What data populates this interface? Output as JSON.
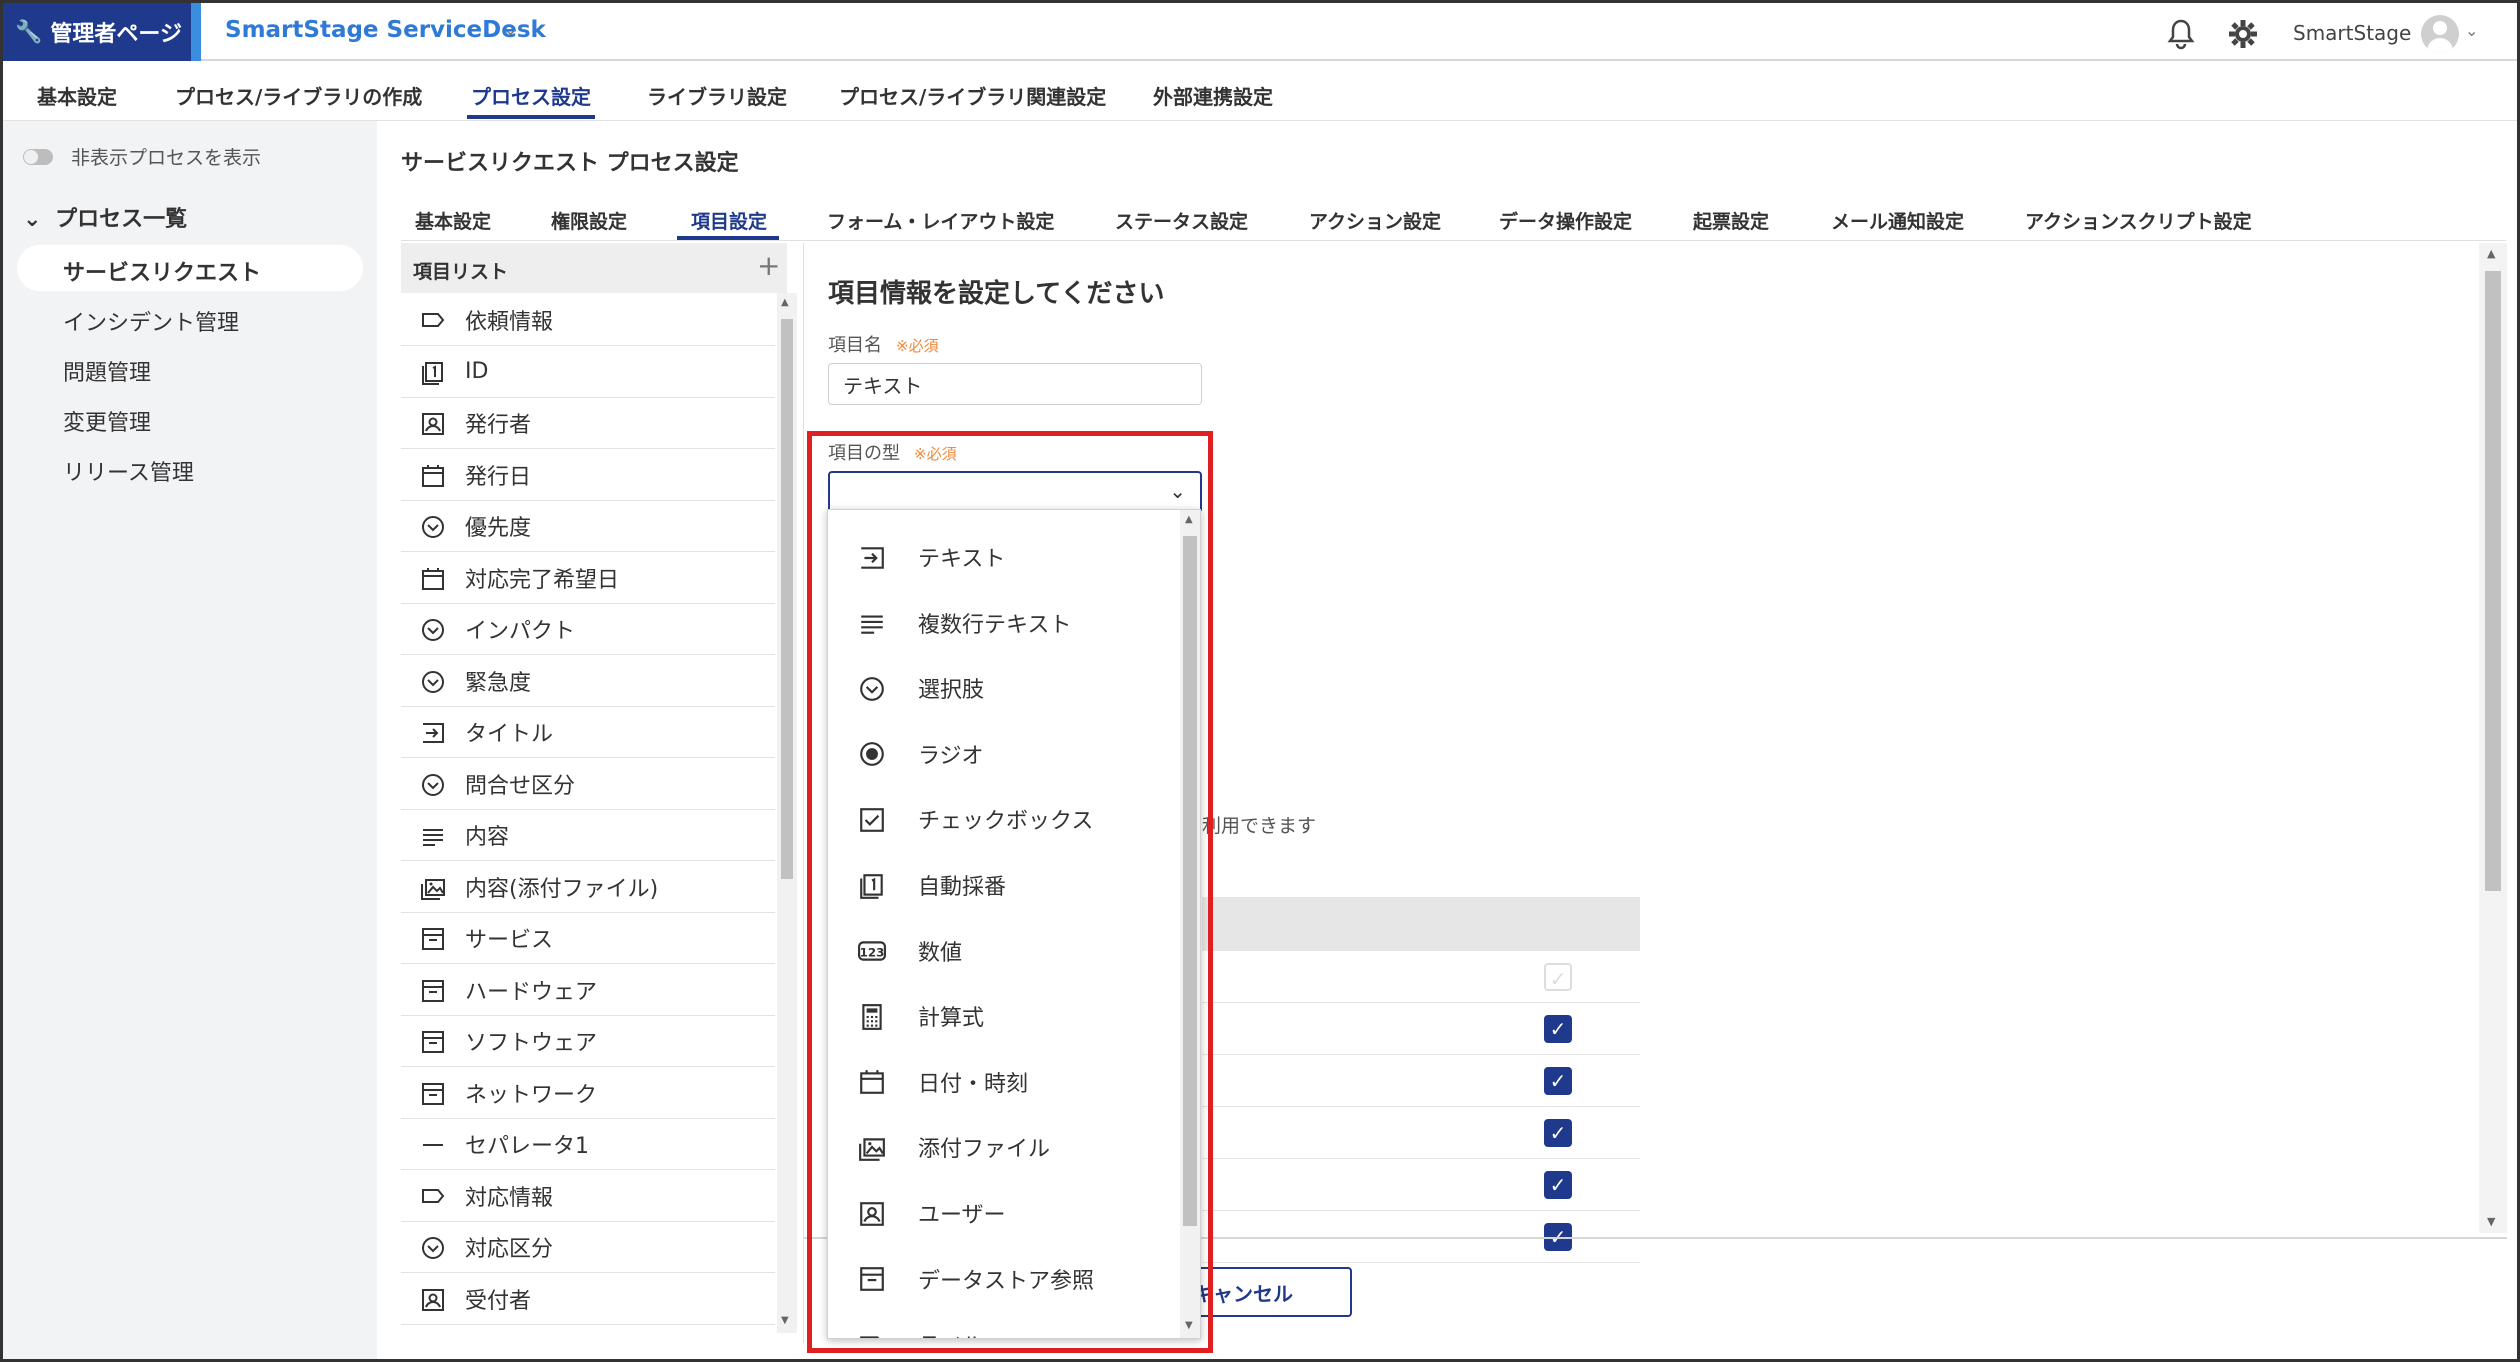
{
  "header": {
    "admin_label": "管理者ページ",
    "app_name": "SmartStage ServiceDesk",
    "user_name": "SmartStage"
  },
  "topnav": {
    "items": [
      "基本設定",
      "プロセス/ライブラリの作成",
      "プロセス設定",
      "ライブラリ設定",
      "プロセス/ライブラリ関連設定",
      "外部連携設定"
    ],
    "active": "プロセス設定"
  },
  "sidebar": {
    "toggle_label": "非表示プロセスを表示",
    "section_title": "プロセス一覧",
    "items": [
      "サービスリクエスト",
      "インシデント管理",
      "問題管理",
      "変更管理",
      "リリース管理"
    ],
    "active": "サービスリクエスト"
  },
  "main": {
    "page_title": "サービスリクエスト プロセス設定",
    "subtabs": [
      "基本設定",
      "権限設定",
      "項目設定",
      "フォーム・レイアウト設定",
      "ステータス設定",
      "アクション設定",
      "データ操作設定",
      "起票設定",
      "メール通知設定",
      "アクションスクリプト設定"
    ],
    "active_subtab": "項目設定"
  },
  "item_list": {
    "header": "項目リスト",
    "items": [
      {
        "icon": "label-icon",
        "label": "依頼情報"
      },
      {
        "icon": "autonumber-icon",
        "label": "ID"
      },
      {
        "icon": "user-icon",
        "label": "発行者"
      },
      {
        "icon": "calendar-icon",
        "label": "発行日"
      },
      {
        "icon": "select-icon",
        "label": "優先度"
      },
      {
        "icon": "calendar-icon",
        "label": "対応完了希望日"
      },
      {
        "icon": "select-icon",
        "label": "インパクト"
      },
      {
        "icon": "select-icon",
        "label": "緊急度"
      },
      {
        "icon": "text-input-icon",
        "label": "タイトル"
      },
      {
        "icon": "select-icon",
        "label": "問合せ区分"
      },
      {
        "icon": "multiline-icon",
        "label": "内容"
      },
      {
        "icon": "attachment-icon",
        "label": "内容(添付ファイル)"
      },
      {
        "icon": "datastore-icon",
        "label": "サービス"
      },
      {
        "icon": "datastore-icon",
        "label": "ハードウェア"
      },
      {
        "icon": "datastore-icon",
        "label": "ソフトウェア"
      },
      {
        "icon": "datastore-icon",
        "label": "ネットワーク"
      },
      {
        "icon": "separator-icon",
        "label": "セパレータ1"
      },
      {
        "icon": "label-icon",
        "label": "対応情報"
      },
      {
        "icon": "select-icon",
        "label": "対応区分"
      },
      {
        "icon": "user-icon",
        "label": "受付者"
      }
    ]
  },
  "form": {
    "title": "項目情報を設定してください",
    "name_label": "項目名",
    "required_mark": "※必須",
    "name_value": "テキスト",
    "type_label": "項目の型",
    "usage_text": "利用できます",
    "cancel_label": "キャンセル"
  },
  "type_dropdown": {
    "options": [
      {
        "icon": "text-input-icon",
        "label": "テキスト"
      },
      {
        "icon": "multiline-icon",
        "label": "複数行テキスト"
      },
      {
        "icon": "select-icon",
        "label": "選択肢"
      },
      {
        "icon": "radio-icon",
        "label": "ラジオ"
      },
      {
        "icon": "checkbox-icon",
        "label": "チェックボックス"
      },
      {
        "icon": "autonumber-icon",
        "label": "自動採番"
      },
      {
        "icon": "number-icon",
        "label": "数値"
      },
      {
        "icon": "calculator-icon",
        "label": "計算式"
      },
      {
        "icon": "calendar-icon",
        "label": "日付・時刻"
      },
      {
        "icon": "attachment-icon",
        "label": "添付ファイル"
      },
      {
        "icon": "user-icon",
        "label": "ユーザー"
      },
      {
        "icon": "datastore-icon",
        "label": "データストア参照"
      },
      {
        "icon": "label-icon",
        "label": "ラベル"
      }
    ]
  },
  "table": {
    "checkbox_states": [
      "disabled",
      "checked",
      "checked",
      "checked",
      "checked",
      "checked"
    ]
  },
  "colors": {
    "brand": "#1f3a8c",
    "accent": "#3b8de0",
    "highlight": "#e02020",
    "required": "#ef8a3c"
  }
}
